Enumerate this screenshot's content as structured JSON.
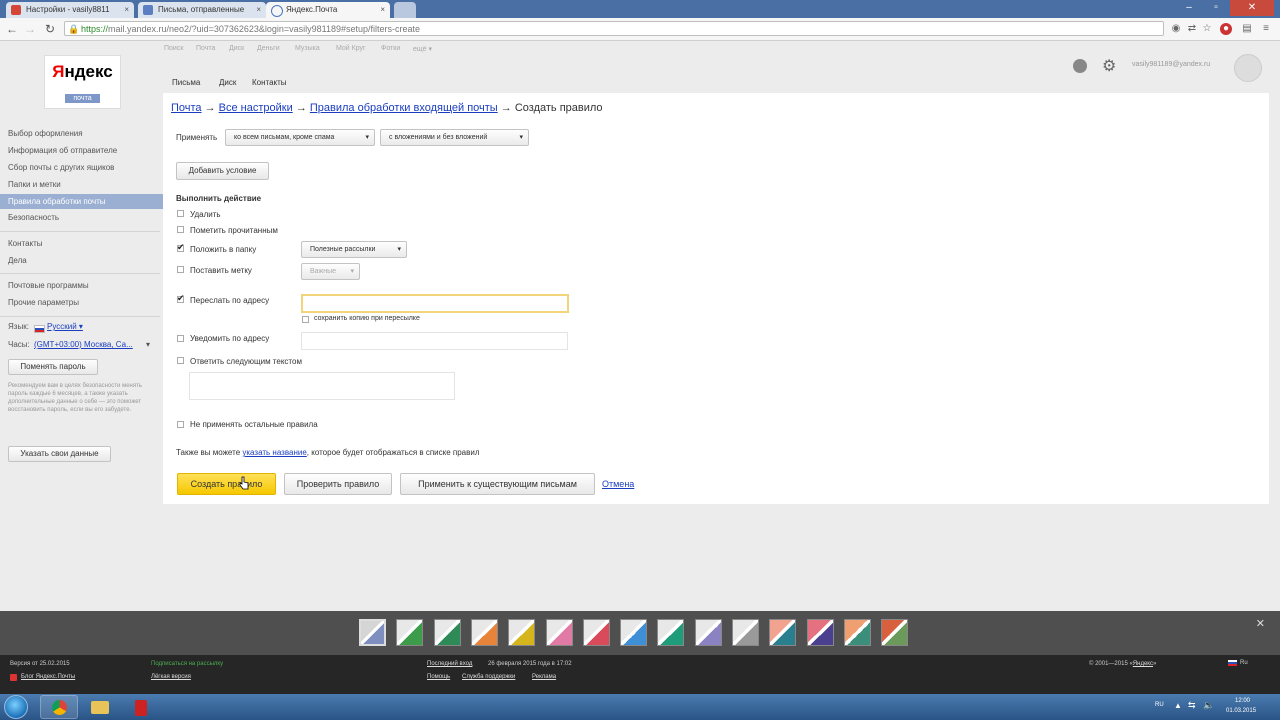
{
  "browser": {
    "tabs": [
      {
        "label": "Настройки - vasily8811",
        "icon_color": "#d44638"
      },
      {
        "label": "Письма, отправленные",
        "icon_color": "#5b7fc2"
      },
      {
        "label": "Яндекс.Почта",
        "icon_color": "#4a78c0"
      }
    ],
    "url_protocol": "https://",
    "url_rest": "mail.yandex.ru/neo2/?uid=307362623&login=vasily981189#setup/filters-create"
  },
  "logo": {
    "first_letter": "Я",
    "rest": "ндекс",
    "sub": "почта"
  },
  "services": [
    "Поиск",
    "Почта",
    "Диск",
    "Деньги",
    "Музыка",
    "Мой Круг",
    "Фотки",
    "ещё ▾"
  ],
  "sub_nav": [
    "Письма",
    "Диск",
    "Контакты"
  ],
  "user": {
    "email": "vasily981189@yandex.ru"
  },
  "breadcrumb": {
    "mail": "Почта",
    "all_settings": "Все настройки",
    "rules": "Правила обработки входящей почты",
    "current": "Создать правило",
    "sep": "→"
  },
  "sidebar": {
    "items": [
      "Выбор оформления",
      "Информация об отправителе",
      "Сбор почты с других ящиков",
      "Папки и метки",
      "Правила обработки почты",
      "Безопасность",
      "Контакты",
      "Дела",
      "Почтовые программы",
      "Прочие параметры"
    ],
    "language_label": "Язык:",
    "language_value": "Русский ▾",
    "clock_label": "Часы:",
    "clock_value": "(GMT+03:00) Москва, Са...",
    "clock_arrow": "▾",
    "change_password": "Поменять пароль",
    "recommend_text": "Рекомендуем вам в целях безопасности менять пароль каждые 6 месяцев, а также указать дополнительные данные о себе — это поможет восстановить пароль, если вы его забудете.",
    "specify_data": "Указать свои данные"
  },
  "form": {
    "apply_label": "Применять",
    "apply_scope": "ко всем письмам, кроме спама",
    "attachments": "с вложениями и без вложений",
    "add_condition": "Добавить условие",
    "actions_title": "Выполнить действие",
    "delete": "Удалить",
    "mark_read": "Пометить прочитанным",
    "move_to_folder": "Положить в папку",
    "folder_value": "Полезные рассылки",
    "set_label": "Поставить метку",
    "label_value": "Важные",
    "forward": "Переслать по адресу",
    "keep_copy": "сохранить копию при пересылке",
    "notify": "Уведомить по адресу",
    "reply": "Ответить следующим текстом",
    "no_other_rules": "Не применять остальные правила",
    "hint_prefix": "Также вы можете",
    "hint_link": "указать название",
    "hint_suffix": ", которое будет отображаться в списке правил",
    "create_rule": "Создать правило",
    "check_rule": "Проверить правило",
    "apply_existing": "Применить к существующим письмам",
    "cancel": "Отмена"
  },
  "themes": [
    {
      "a": "#7e8fbf",
      "b": "#d5d5d5"
    },
    {
      "a": "#3d9c4a",
      "b": "#e8e8e8"
    },
    {
      "a": "#2e8b57",
      "b": "#e8e8e8"
    },
    {
      "a": "#e8833a",
      "b": "#e8e8e8"
    },
    {
      "a": "#d4b51c",
      "b": "#e8e8e8"
    },
    {
      "a": "#e17aa5",
      "b": "#e8e8e8"
    },
    {
      "a": "#d94a5a",
      "b": "#e8e8e8"
    },
    {
      "a": "#3f8fd6",
      "b": "#e8e8e8"
    },
    {
      "a": "#1f9c7a",
      "b": "#e8e8e8"
    },
    {
      "a": "#8b82c4",
      "b": "#e8e8e8"
    },
    {
      "a": "#9a9a9a",
      "b": "#e8e8e8"
    },
    {
      "a": "#2a7f8f",
      "b": "#f2a38f"
    },
    {
      "a": "#4b3f8f",
      "b": "#e5707f"
    },
    {
      "a": "#3b8f7a",
      "b": "#f0a070"
    },
    {
      "a": "#6c9a5a",
      "b": "#d9603f"
    }
  ],
  "footer": {
    "version": "Версия от 25.02.2015",
    "blog": "Блог Яндекс.Почты",
    "new_help": "Подписаться на рассылку",
    "light": "Лёгкая версия",
    "last_login_link": "Последний вход",
    "last_login_text": "26 февраля 2015 года в 17:02",
    "help": "Помощь",
    "support": "Служба поддержки",
    "ads": "Реклама",
    "copyright_prefix": "© 2001—2015 «",
    "copyright_link": "Яндекс",
    "copyright_suffix": "»",
    "lang": "Ru"
  },
  "taskbar": {
    "lang": "RU",
    "time": "12:00",
    "date": "01.03.2015"
  }
}
